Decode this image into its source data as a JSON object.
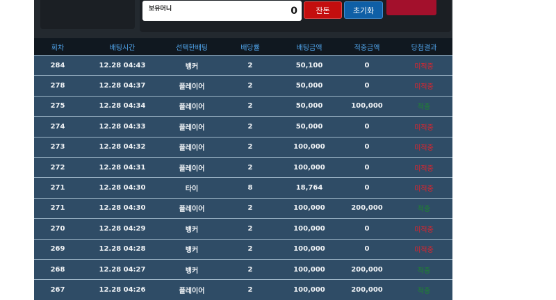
{
  "top": {
    "money_label": "보유머니",
    "money_value": "0",
    "balance_button": "잔돈",
    "reset_button": "초기화",
    "right_button": ""
  },
  "table": {
    "headers": [
      "회차",
      "배팅시간",
      "선택한배팅",
      "배당률",
      "배팅금액",
      "적중금액",
      "당첨결과"
    ],
    "rows": [
      {
        "round": "284",
        "time": "12.28 04:43",
        "pick": "뱅커",
        "odds": "2",
        "bet": "50,100",
        "win": "0",
        "result": "미적중"
      },
      {
        "round": "278",
        "time": "12.28 04:37",
        "pick": "플레이어",
        "odds": "2",
        "bet": "50,000",
        "win": "0",
        "result": "미적중"
      },
      {
        "round": "275",
        "time": "12.28 04:34",
        "pick": "플레이어",
        "odds": "2",
        "bet": "50,000",
        "win": "100,000",
        "result": "적중"
      },
      {
        "round": "274",
        "time": "12.28 04:33",
        "pick": "플레이어",
        "odds": "2",
        "bet": "50,000",
        "win": "0",
        "result": "미적중"
      },
      {
        "round": "273",
        "time": "12.28 04:32",
        "pick": "플레이어",
        "odds": "2",
        "bet": "100,000",
        "win": "0",
        "result": "미적중"
      },
      {
        "round": "272",
        "time": "12.28 04:31",
        "pick": "플레이어",
        "odds": "2",
        "bet": "100,000",
        "win": "0",
        "result": "미적중"
      },
      {
        "round": "271",
        "time": "12.28 04:30",
        "pick": "타이",
        "odds": "8",
        "bet": "18,764",
        "win": "0",
        "result": "미적중"
      },
      {
        "round": "271",
        "time": "12.28 04:30",
        "pick": "플레이어",
        "odds": "2",
        "bet": "100,000",
        "win": "200,000",
        "result": "적중"
      },
      {
        "round": "270",
        "time": "12.28 04:29",
        "pick": "뱅커",
        "odds": "2",
        "bet": "100,000",
        "win": "0",
        "result": "미적중"
      },
      {
        "round": "269",
        "time": "12.28 04:28",
        "pick": "뱅커",
        "odds": "2",
        "bet": "100,000",
        "win": "0",
        "result": "미적중"
      },
      {
        "round": "268",
        "time": "12.28 04:27",
        "pick": "뱅커",
        "odds": "2",
        "bet": "100,000",
        "win": "200,000",
        "result": "적중"
      },
      {
        "round": "267",
        "time": "12.28 04:26",
        "pick": "플레이어",
        "odds": "2",
        "bet": "100,000",
        "win": "200,000",
        "result": "적중"
      }
    ]
  },
  "colors": {
    "lose": "#e8222a",
    "win": "#1c8a2a",
    "header_text": "#52a8f0",
    "row_bg": "#2f4c66"
  }
}
